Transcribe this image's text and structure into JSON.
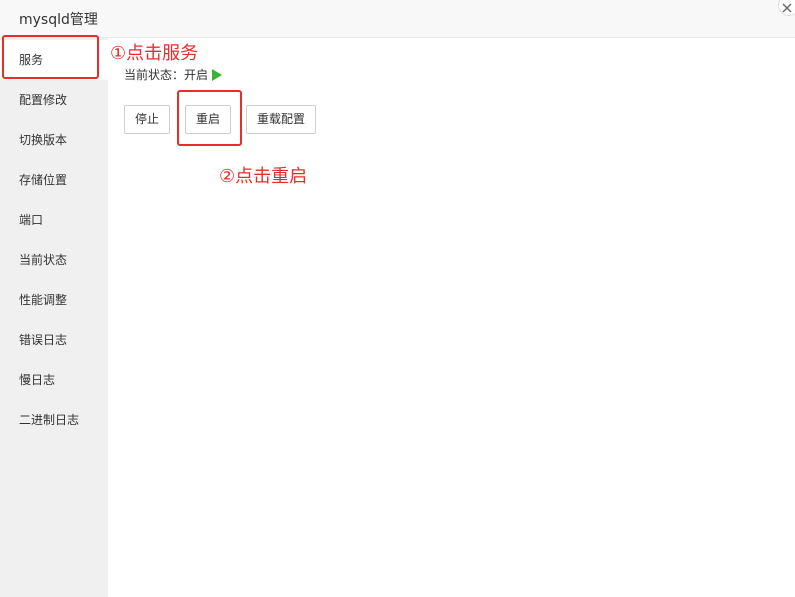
{
  "window": {
    "title": "mysqld管理"
  },
  "sidebar": {
    "items": [
      {
        "label": "服务"
      },
      {
        "label": "配置修改"
      },
      {
        "label": "切换版本"
      },
      {
        "label": "存储位置"
      },
      {
        "label": "端口"
      },
      {
        "label": "当前状态"
      },
      {
        "label": "性能调整"
      },
      {
        "label": "错误日志"
      },
      {
        "label": "慢日志"
      },
      {
        "label": "二进制日志"
      }
    ]
  },
  "main": {
    "status_label": "当前状态：开启",
    "status_icon": "play-icon",
    "status_color": "#3bb33b",
    "buttons": {
      "stop": "停止",
      "restart": "重启",
      "reload": "重载配置"
    }
  },
  "annotations": {
    "step1": "①点击服务",
    "step2": "②点击重启",
    "color": "#e82d2d"
  }
}
